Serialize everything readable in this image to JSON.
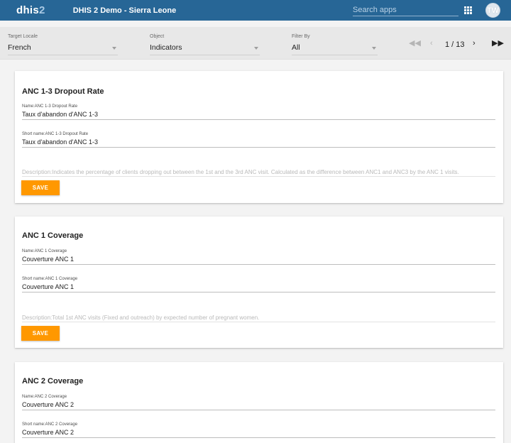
{
  "header": {
    "logo_main": "dhis",
    "logo_num": "2",
    "app_title": "DHIS 2 Demo - Sierra Leone",
    "search_placeholder": "Search apps",
    "apps_icon": "apps-grid-icon",
    "avatar_initials": "TW"
  },
  "toolbar": {
    "target_locale": {
      "label": "Target Locale",
      "value": "French"
    },
    "object": {
      "label": "Object",
      "value": "Indicators"
    },
    "filter_by": {
      "label": "Filter By",
      "value": "All"
    },
    "pager": {
      "page_text": "1 / 13",
      "first_icon": "first-page-icon",
      "prev_icon": "prev-page-icon",
      "next_icon": "next-page-icon",
      "last_icon": "last-page-icon"
    }
  },
  "cards": [
    {
      "title": "ANC 1-3 Dropout Rate",
      "name_label": "Name:ANC 1-3 Dropout Rate",
      "name_value": "Taux d'abandon d'ANC 1-3",
      "short_label": "Short name:ANC 1-3 Dropout Rate",
      "short_value": "Taux d'abandon d'ANC 1-3",
      "description": "Description:Indicates the percentage of clients dropping out between the 1st and the 3rd ANC visit. Calculated as the difference between ANC1 and ANC3 by the ANC 1 visits.",
      "save_label": "SAVE"
    },
    {
      "title": "ANC 1 Coverage",
      "name_label": "Name:ANC 1 Coverage",
      "name_value": "Couverture ANC 1",
      "short_label": "Short name:ANC 1 Coverage",
      "short_value": "Couverture ANC 1",
      "description": "Description:Total 1st ANC visits (Fixed and outreach) by expected number of pregnant women.",
      "save_label": "SAVE"
    },
    {
      "title": "ANC 2 Coverage",
      "name_label": "Name:ANC 2 Coverage",
      "name_value": "Couverture ANC 2",
      "short_label": "Short name:ANC 2 Coverage",
      "short_value": "Couverture ANC 2"
    }
  ],
  "colors": {
    "header_bg": "#276696",
    "accent": "#ff9800",
    "page_bg": "#f3f3f3"
  }
}
